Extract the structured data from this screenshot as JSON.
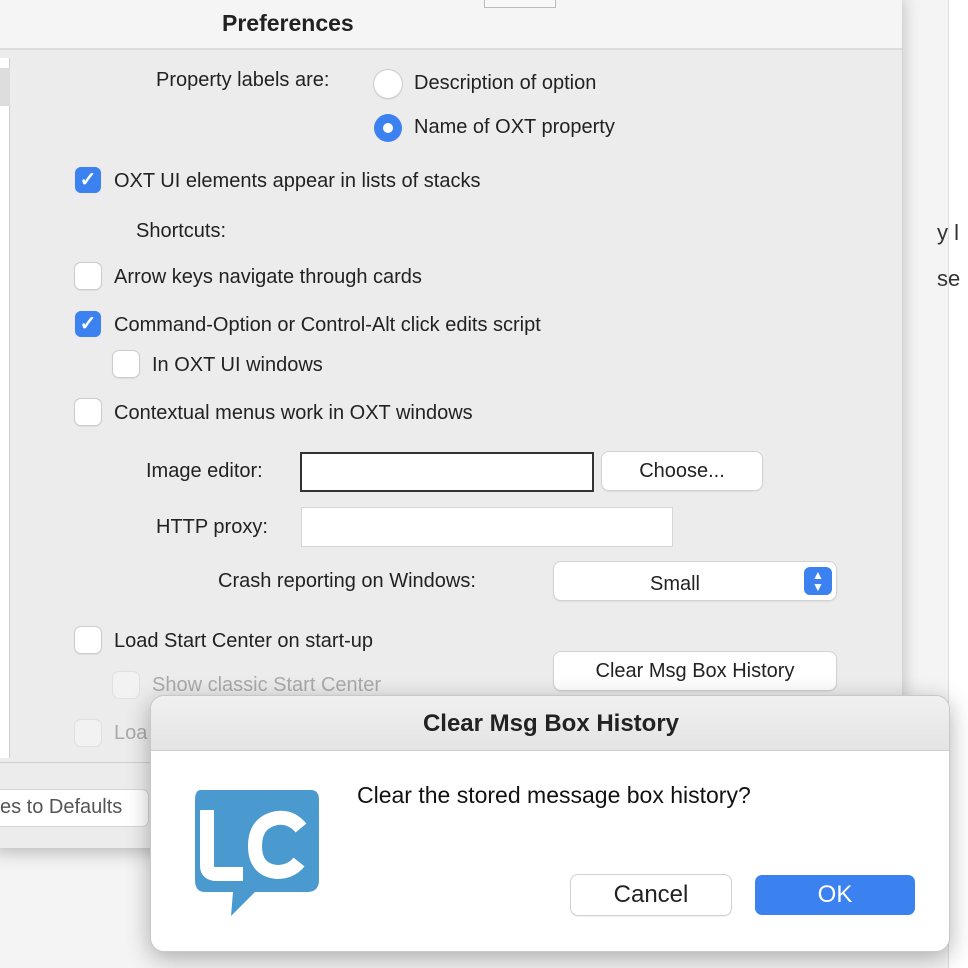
{
  "background_window": {
    "fragments": [
      "y l",
      "se"
    ]
  },
  "prefs": {
    "title": "Preferences",
    "property_labels_label": "Property labels are:",
    "radio_options": [
      {
        "label": "Description of option",
        "selected": false
      },
      {
        "label": "Name of OXT property",
        "selected": true
      }
    ],
    "checkbox_oxt_ui": {
      "label": "OXT UI elements appear in lists of stacks",
      "checked": true
    },
    "shortcuts_label": "Shortcuts:",
    "checkbox_arrow_keys": {
      "label": "Arrow keys navigate through cards",
      "checked": false
    },
    "checkbox_cmd_option": {
      "label": "Command-Option or Control-Alt click edits script",
      "checked": true
    },
    "checkbox_in_oxt_ui": {
      "label": "In OXT UI windows",
      "checked": false
    },
    "checkbox_contextual": {
      "label": "Contextual menus work in OXT windows",
      "checked": false
    },
    "image_editor_label": "Image editor:",
    "image_editor_value": "",
    "choose_button": "Choose...",
    "http_proxy_label": "HTTP proxy:",
    "http_proxy_value": "",
    "crash_reporting_label": "Crash reporting on Windows:",
    "crash_reporting_value": "Small",
    "checkbox_load_start": {
      "label": "Load Start Center on start-up",
      "checked": false
    },
    "checkbox_classic": {
      "label": "Show classic Start Center",
      "checked": false,
      "disabled": true
    },
    "checkbox_load_partial": {
      "label": "Loa",
      "checked": false,
      "disabled": true
    },
    "clear_history_button": "Clear Msg Box History",
    "defaults_button": "es to Defaults"
  },
  "dialog": {
    "title": "Clear Msg Box History",
    "message": "Clear the stored message box history?",
    "icon": "livecode-logo-icon",
    "logo_text": "lc",
    "cancel_label": "Cancel",
    "ok_label": "OK"
  },
  "colors": {
    "accent": "#3b82f0",
    "logo": "#4a9ad0"
  }
}
